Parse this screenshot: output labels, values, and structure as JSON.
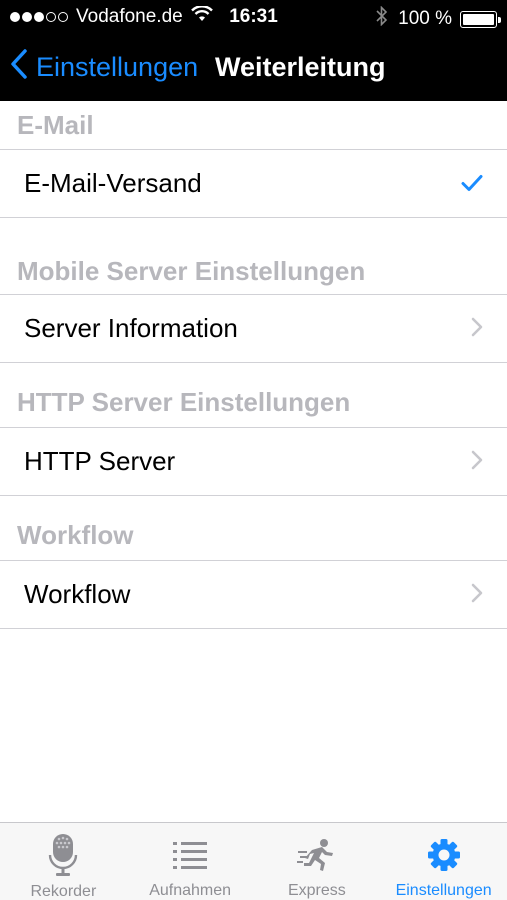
{
  "status_bar": {
    "carrier": "Vodafone.de",
    "time": "16:31",
    "battery": "100 %",
    "signal_bars_filled": 3,
    "signal_bars_total": 5
  },
  "nav": {
    "back_label": "Einstellungen",
    "title": "Weiterleitung"
  },
  "sections": [
    {
      "header": "E-Mail",
      "row": "E-Mail-Versand",
      "accessory": "checkmark"
    },
    {
      "header": "Mobile Server Einstellungen",
      "row": "Server Information",
      "accessory": "chevron"
    },
    {
      "header": "HTTP Server Einstellungen",
      "row": "HTTP Server",
      "accessory": "chevron"
    },
    {
      "header": "Workflow",
      "row": "Workflow",
      "accessory": "chevron"
    }
  ],
  "tabs": [
    {
      "label": "Rekorder",
      "icon": "microphone-icon"
    },
    {
      "label": "Aufnahmen",
      "icon": "list-icon"
    },
    {
      "label": "Express",
      "icon": "running-man-icon"
    },
    {
      "label": "Einstellungen",
      "icon": "gear-icon",
      "active": true
    }
  ],
  "colors": {
    "accent": "#1a8cff",
    "section_header": "#b7b7bc",
    "tab_inactive": "#8e8e93"
  }
}
